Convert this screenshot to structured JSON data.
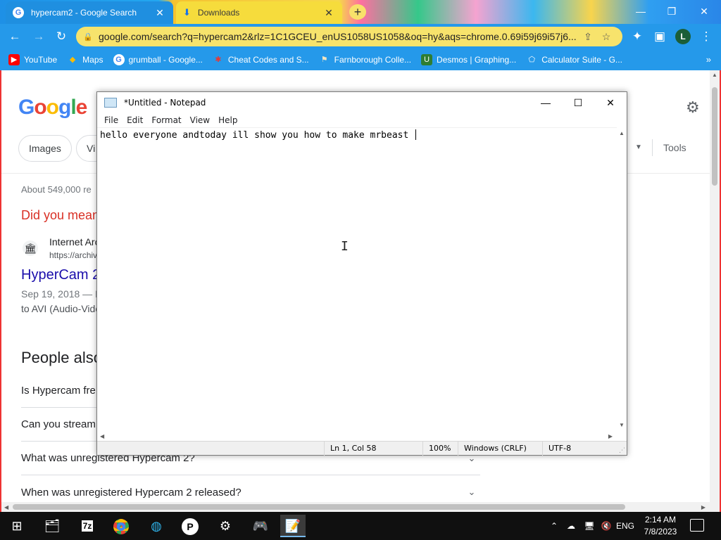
{
  "chrome": {
    "tabs": [
      {
        "label": "hypercam2 - Google Search",
        "close": "✕"
      },
      {
        "label": "Downloads",
        "close": "✕"
      }
    ],
    "new_tab": "+",
    "window_controls": {
      "minimize": "—",
      "maximize": "❐",
      "close": "✕"
    },
    "url": "google.com/search?q=hypercam2&rlz=1C1GCEU_enUS1058US1058&oq=hy&aqs=chrome.0.69i59j69i57j6...",
    "avatar_letter": "L",
    "bookmarks": [
      {
        "label": "YouTube"
      },
      {
        "label": "Maps"
      },
      {
        "label": "grumball - Google..."
      },
      {
        "label": "Cheat Codes and S..."
      },
      {
        "label": "Farnborough Colle..."
      },
      {
        "label": "Desmos | Graphing..."
      },
      {
        "label": "Calculator Suite - G..."
      }
    ],
    "bookmarks_overflow": "»"
  },
  "google": {
    "logo": {
      "g": "G",
      "o1": "o",
      "o2": "o",
      "g2": "g",
      "l": "l",
      "e": "e"
    },
    "chips": {
      "images": "Images",
      "videos": "Vi"
    },
    "tools": "Tools",
    "result_stats": "About 549,000 re",
    "did_you_mean": "Did you mean",
    "result": {
      "site_name": "Internet Arc",
      "site_url": "https://archiv",
      "title": "HyperCam 2",
      "date": "Sep 19, 2018 — H",
      "snippet": "to AVI (Audio-Vide"
    },
    "paa": {
      "heading": "People also",
      "items": [
        "Is Hypercam fre",
        "Can you stream",
        "What was unregistered Hypercam 2?",
        "When was unregistered Hypercam 2 released?"
      ]
    }
  },
  "notepad": {
    "title": "*Untitled - Notepad",
    "controls": {
      "minimize": "—",
      "maximize": "☐",
      "close": "✕"
    },
    "menu": [
      "File",
      "Edit",
      "Format",
      "View",
      "Help"
    ],
    "content": "hello everyone andtoday ill show you how to make mrbeast ",
    "status": {
      "position": "Ln 1, Col 58",
      "zoom": "100%",
      "line_endings": "Windows (CRLF)",
      "encoding": "UTF-8"
    }
  },
  "taskbar": {
    "apps": [
      "start",
      "file-manager",
      "7-zip",
      "chrome",
      "edge",
      "picsart",
      "settings",
      "game",
      "notepad"
    ],
    "tray": {
      "language": "ENG"
    },
    "clock": {
      "time": "2:14 AM",
      "date": "7/8/2023"
    }
  },
  "colors": {
    "chrome_toolbar": "#2599ea",
    "omnibox": "#f7e36c",
    "google_link": "#1a0dab",
    "did_you_mean": "#d93025",
    "taskbar": "#101010"
  }
}
